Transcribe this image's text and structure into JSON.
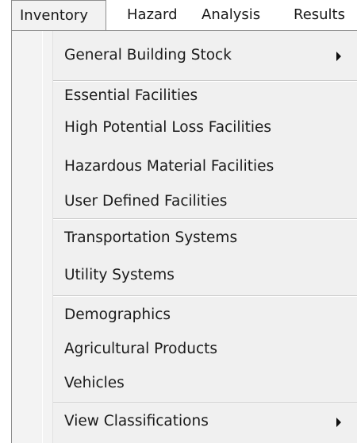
{
  "menubar": {
    "items": [
      {
        "label": "Inventory"
      },
      {
        "label": "Hazard"
      },
      {
        "label": "Analysis"
      },
      {
        "label": "Results"
      }
    ]
  },
  "inventory_menu": {
    "items": [
      {
        "label": "General Building Stock",
        "has_submenu": true
      },
      {
        "label": "Essential Facilities"
      },
      {
        "label": "High Potential Loss Facilities"
      },
      {
        "label": "Hazardous Material Facilities"
      },
      {
        "label": "User Defined Facilities"
      },
      {
        "label": "Transportation Systems"
      },
      {
        "label": "Utility Systems"
      },
      {
        "label": "Demographics"
      },
      {
        "label": "Agricultural Products"
      },
      {
        "label": "Vehicles"
      },
      {
        "label": "View Classifications",
        "has_submenu": true
      }
    ]
  },
  "colors": {
    "menu_background": "#f0f0f0",
    "text": "#1a1a1a",
    "separator": "#c8c8c8",
    "border": "#8e8e8e"
  },
  "icons": {
    "submenu": "chevron-right-icon"
  }
}
